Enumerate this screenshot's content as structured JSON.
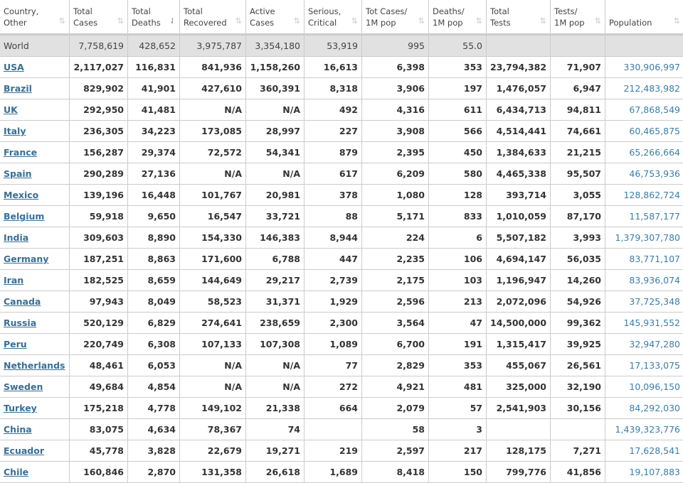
{
  "columns": [
    {
      "l1": "Country,",
      "l2": "Other"
    },
    {
      "l1": "Total",
      "l2": "Cases"
    },
    {
      "l1": "Total",
      "l2": "Deaths"
    },
    {
      "l1": "Total",
      "l2": "Recovered"
    },
    {
      "l1": "Active",
      "l2": "Cases"
    },
    {
      "l1": "Serious,",
      "l2": "Critical"
    },
    {
      "l1": "Tot Cases/",
      "l2": "1M pop"
    },
    {
      "l1": "Deaths/",
      "l2": "1M pop"
    },
    {
      "l1": "Total",
      "l2": "Tests"
    },
    {
      "l1": "Tests/",
      "l2": "1M pop"
    },
    {
      "l1": "",
      "l2": "Population"
    }
  ],
  "sort_icon": "⇅",
  "sort_active_icon": "⇃",
  "world": [
    "World",
    "7,758,619",
    "428,652",
    "3,975,787",
    "3,354,180",
    "53,919",
    "995",
    "55.0",
    "",
    "",
    ""
  ],
  "rows": [
    [
      "USA",
      "2,117,027",
      "116,831",
      "841,936",
      "1,158,260",
      "16,613",
      "6,398",
      "353",
      "23,794,382",
      "71,907",
      "330,906,997"
    ],
    [
      "Brazil",
      "829,902",
      "41,901",
      "427,610",
      "360,391",
      "8,318",
      "3,906",
      "197",
      "1,476,057",
      "6,947",
      "212,483,982"
    ],
    [
      "UK",
      "292,950",
      "41,481",
      "N/A",
      "N/A",
      "492",
      "4,316",
      "611",
      "6,434,713",
      "94,811",
      "67,868,549"
    ],
    [
      "Italy",
      "236,305",
      "34,223",
      "173,085",
      "28,997",
      "227",
      "3,908",
      "566",
      "4,514,441",
      "74,661",
      "60,465,875"
    ],
    [
      "France",
      "156,287",
      "29,374",
      "72,572",
      "54,341",
      "879",
      "2,395",
      "450",
      "1,384,633",
      "21,215",
      "65,266,664"
    ],
    [
      "Spain",
      "290,289",
      "27,136",
      "N/A",
      "N/A",
      "617",
      "6,209",
      "580",
      "4,465,338",
      "95,507",
      "46,753,936"
    ],
    [
      "Mexico",
      "139,196",
      "16,448",
      "101,767",
      "20,981",
      "378",
      "1,080",
      "128",
      "393,714",
      "3,055",
      "128,862,724"
    ],
    [
      "Belgium",
      "59,918",
      "9,650",
      "16,547",
      "33,721",
      "88",
      "5,171",
      "833",
      "1,010,059",
      "87,170",
      "11,587,177"
    ],
    [
      "India",
      "309,603",
      "8,890",
      "154,330",
      "146,383",
      "8,944",
      "224",
      "6",
      "5,507,182",
      "3,993",
      "1,379,307,780"
    ],
    [
      "Germany",
      "187,251",
      "8,863",
      "171,600",
      "6,788",
      "447",
      "2,235",
      "106",
      "4,694,147",
      "56,035",
      "83,771,107"
    ],
    [
      "Iran",
      "182,525",
      "8,659",
      "144,649",
      "29,217",
      "2,739",
      "2,175",
      "103",
      "1,196,947",
      "14,260",
      "83,936,074"
    ],
    [
      "Canada",
      "97,943",
      "8,049",
      "58,523",
      "31,371",
      "1,929",
      "2,596",
      "213",
      "2,072,096",
      "54,926",
      "37,725,348"
    ],
    [
      "Russia",
      "520,129",
      "6,829",
      "274,641",
      "238,659",
      "2,300",
      "3,564",
      "47",
      "14,500,000",
      "99,362",
      "145,931,552"
    ],
    [
      "Peru",
      "220,749",
      "6,308",
      "107,133",
      "107,308",
      "1,089",
      "6,700",
      "191",
      "1,315,417",
      "39,925",
      "32,947,280"
    ],
    [
      "Netherlands",
      "48,461",
      "6,053",
      "N/A",
      "N/A",
      "77",
      "2,829",
      "353",
      "455,067",
      "26,561",
      "17,133,075"
    ],
    [
      "Sweden",
      "49,684",
      "4,854",
      "N/A",
      "N/A",
      "272",
      "4,921",
      "481",
      "325,000",
      "32,190",
      "10,096,150"
    ],
    [
      "Turkey",
      "175,218",
      "4,778",
      "149,102",
      "21,338",
      "664",
      "2,079",
      "57",
      "2,541,903",
      "30,156",
      "84,292,030"
    ],
    [
      "China",
      "83,075",
      "4,634",
      "78,367",
      "74",
      "",
      "58",
      "3",
      "",
      "",
      "1,439,323,776"
    ],
    [
      "Ecuador",
      "45,778",
      "3,828",
      "22,679",
      "19,271",
      "219",
      "2,597",
      "217",
      "128,175",
      "7,271",
      "17,628,541"
    ],
    [
      "Chile",
      "160,846",
      "2,870",
      "131,358",
      "26,618",
      "1,689",
      "8,418",
      "150",
      "799,776",
      "41,856",
      "19,107,883"
    ]
  ]
}
